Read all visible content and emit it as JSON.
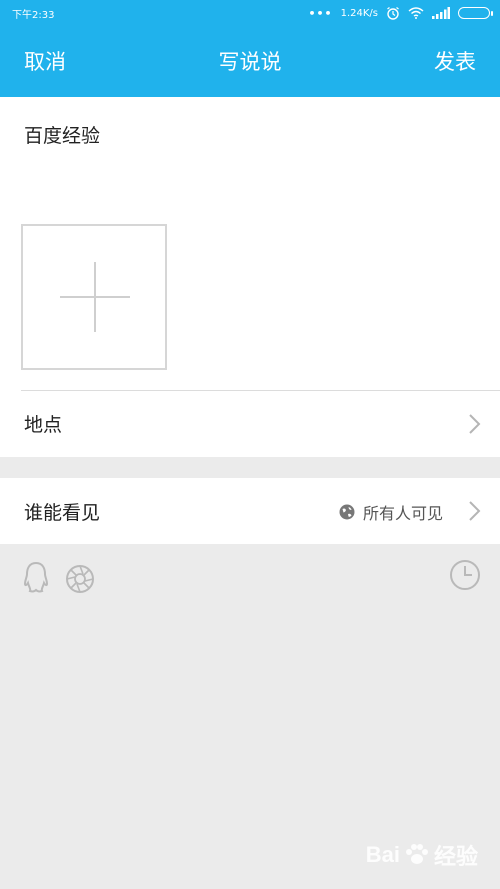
{
  "status_bar": {
    "time": "下午2:33",
    "speed": "1.24K/s"
  },
  "nav": {
    "cancel_label": "取消",
    "title": "写说说",
    "publish_label": "发表"
  },
  "compose": {
    "text": "百度经验"
  },
  "location": {
    "label": "地点"
  },
  "visibility": {
    "label": "谁能看见",
    "value": "所有人可见"
  },
  "watermark": {
    "text": "Bai",
    "suffix": "经验"
  },
  "colors": {
    "header": "#20b2ec",
    "background": "#ebebeb"
  }
}
